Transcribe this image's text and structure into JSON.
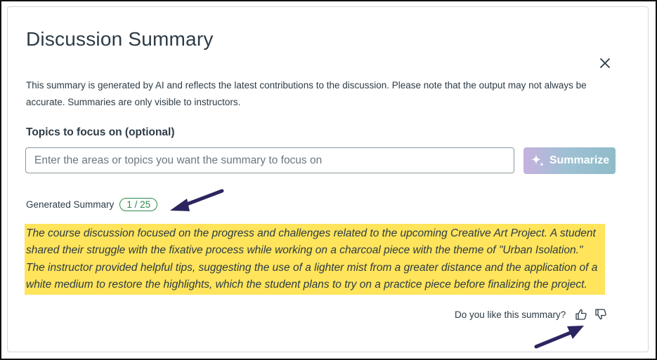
{
  "dialog": {
    "title": "Discussion Summary",
    "description": "This summary is generated by AI and reflects the latest contributions to the discussion. Please note that the output may not always be accurate. Summaries are only visible to instructors.",
    "close_icon": "close-icon"
  },
  "topics": {
    "label": "Topics to focus on (optional)",
    "value": "",
    "placeholder": "Enter the areas or topics you want the summary to focus on"
  },
  "summarize_button": {
    "label": "Summarize",
    "icon": "sparkle-icon"
  },
  "generated": {
    "label": "Generated Summary",
    "counter": "1 / 25"
  },
  "summary": {
    "text": "The course discussion focused on the progress and challenges related to the upcoming Creative Art Project. A student shared their struggle with the fixative process while working on a charcoal piece with the theme of \"Urban Isolation.\" The instructor provided helpful tips, suggesting the use of a lighter mist from a greater distance and the application of a white medium to restore the highlights, which the student plans to try on a practice piece before finalizing the project."
  },
  "feedback": {
    "question": "Do you like this summary?",
    "like_icon": "thumbs-up-icon",
    "dislike_icon": "thumbs-down-icon"
  },
  "colors": {
    "highlight": "#ffe45c",
    "badge": "#2d8a4a",
    "annotation_arrow": "#2b2560",
    "text": "#2d3b45"
  }
}
